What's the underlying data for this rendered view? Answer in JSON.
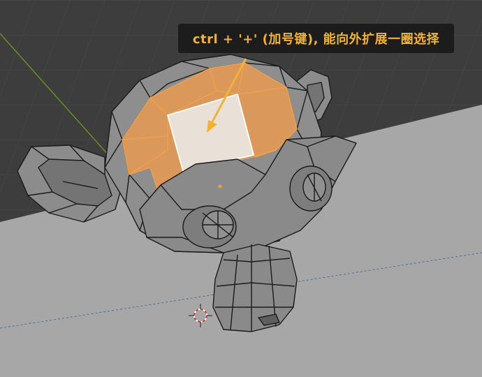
{
  "tooltip": {
    "text": "ctrl + '+' (加号键), 能向外扩展一圈选择"
  },
  "colors": {
    "background_grid": "#3d3d3d",
    "floor": "#a7a7a7",
    "mesh_face": "#8a8a8a",
    "mesh_edge": "#1a1a1a",
    "selection": "#f0a04b",
    "active_face": "#ffffff",
    "tooltip_bg": "#1c1c1c",
    "tooltip_text": "#f2b23a",
    "y_axis": "#6b8e23",
    "arrow": "#f2b23a"
  },
  "icons": {
    "cursor": "3d-cursor-icon"
  }
}
